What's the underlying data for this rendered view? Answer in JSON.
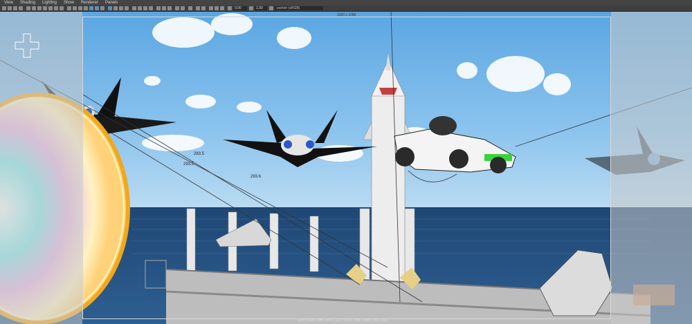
{
  "menu": [
    "View",
    "Shading",
    "Lighting",
    "Show",
    "Renderer",
    "Panels"
  ],
  "toolbar": {
    "exposure": "0.00",
    "gamma": "1.00",
    "colorspace": "pointer (sRGB)"
  },
  "viewport": {
    "resolution_label": "1920 x 1080",
    "camera_label": "s006_0020_cam_1001_1111_1920_1080_30fps_558_u001",
    "measure_1": "283.5",
    "measure_2": "293.5",
    "measure_3": "293.6"
  },
  "colors": {
    "sky": "#6db1e4",
    "sea": "#2a4d7a",
    "ui_bg": "#444444",
    "active_icon": "#5a8ec0"
  }
}
